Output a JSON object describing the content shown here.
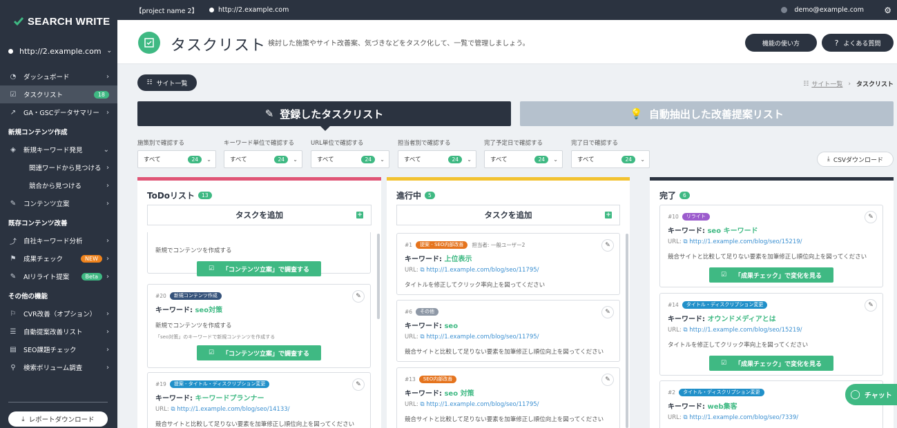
{
  "sidebar": {
    "logo": "SEARCH WRITE",
    "site": "http://2.example.com",
    "items": [
      {
        "icon": "speedometer-icon",
        "label": "ダッシュボード"
      },
      {
        "icon": "checklist-icon",
        "label": "タスクリスト",
        "badge": "18"
      },
      {
        "icon": "chart-icon",
        "label": "GA・GSCデータサマリー"
      }
    ],
    "section_new": "新規コンテンツ作成",
    "new_items": [
      {
        "icon": "layers-icon",
        "label": "新規キーワード発見"
      },
      {
        "label": "関連ワードから見つける"
      },
      {
        "label": "競合から見つける"
      },
      {
        "icon": "edit-icon",
        "label": "コンテンツ立案"
      }
    ],
    "section_existing": "既存コンテンツ改善",
    "existing_items": [
      {
        "icon": "trend-icon",
        "label": "自社キーワード分析"
      },
      {
        "icon": "flag-icon",
        "label": "成果チェック",
        "badge": "NEW"
      },
      {
        "icon": "ai-edit-icon",
        "label": "AIリライト提案",
        "badge": "Beta"
      }
    ],
    "section_other": "その他の機能",
    "other_items": [
      {
        "icon": "flag-outline-icon",
        "label": "CVR改善（オプション）"
      },
      {
        "icon": "list-icon",
        "label": "自動提案改善リスト"
      },
      {
        "icon": "seo-icon",
        "label": "SEO課題チェック"
      },
      {
        "icon": "search-icon",
        "label": "検索ボリューム調査"
      }
    ],
    "report_btn": "レポートダウンロード"
  },
  "topbar": {
    "project": "【project name 2】",
    "site": "http://2.example.com",
    "user": "demo@example.com"
  },
  "header": {
    "title": "タスクリスト",
    "desc": "検討した施策やサイト改善案、気づきなどをタスク化して、一覧で管理しましょう。",
    "btn_usage": "機能の使い方",
    "btn_faq": "よくある質問"
  },
  "site_list_btn": "サイト一覧",
  "breadcrumb": {
    "link": "サイト一覧",
    "current": "タスクリスト"
  },
  "tabs": {
    "registered": "登録したタスクリスト",
    "auto": "自動抽出した改善提案リスト"
  },
  "filters": [
    {
      "label": "施策別で確認する",
      "value": "すべて",
      "count": "24"
    },
    {
      "label": "キーワード単位で確認する",
      "value": "すべて",
      "count": "24"
    },
    {
      "label": "URL単位で確認する",
      "value": "すべて",
      "count": "24"
    },
    {
      "label": "担当者別で確認する",
      "value": "すべて",
      "count": "24"
    },
    {
      "label": "完了予定日で確認する",
      "value": "すべて",
      "count": "24"
    },
    {
      "label": "完了日で確認する",
      "value": "すべて",
      "count": "24"
    }
  ],
  "csv_btn": "CSVダウンロード",
  "add_task": "タスクを追加",
  "kw_label": "キーワード: ",
  "url_label": "URL: ",
  "columns": {
    "todo": {
      "title": "ToDoリスト",
      "count": "13",
      "color": "#e05576"
    },
    "doing": {
      "title": "進行中",
      "count": "5",
      "color": "#f2c230"
    },
    "done": {
      "title": "完了",
      "count": "6",
      "color": "#2b3340"
    }
  },
  "todo_cards": {
    "partial": {
      "desc": "新規でコンテンツを作成する",
      "btn": "「コンテンツ立案」で調査する"
    },
    "c20": {
      "id": "#20",
      "tag": "新規コンテンツ作成",
      "keyword": "seo対策",
      "desc": "新規でコンテンツを作成する",
      "note": "「seo対策」のキーワードで新規コンテンツを作成する",
      "btn": "「コンテンツ立案」で調査する"
    },
    "c19": {
      "id": "#19",
      "tag": "提案 - タイトル・ディスクリプション変更",
      "keyword": "キーワードプランナー",
      "url": "http://1.example.com/blog/seo/14133/",
      "desc": "競合サイトと比較して足りない要素を加筆修正し順位向上を図ってください"
    }
  },
  "doing_cards": {
    "c1": {
      "id": "#1",
      "tag": "提案 - SEO内部改善",
      "assignee": "担当者: 一般ユーザー2",
      "keyword": "上位表示",
      "url": "http://1.example.com/blog/seo/11795/",
      "desc": "タイトルを修正してクリック率向上を図ってください"
    },
    "c6": {
      "id": "#6",
      "tag": "その他",
      "keyword": "seo",
      "url": "http://1.example.com/blog/seo/11795/",
      "desc": "競合サイトと比較して足りない要素を加筆修正し順位向上を図ってください"
    },
    "c13": {
      "id": "#13",
      "tag": "SEO内部改善",
      "keyword": "seo 対策",
      "url": "http://1.example.com/blog/seo/11795/",
      "desc": "競合サイトと比較して足りない要素を加筆修正し順位向上を図ってください"
    }
  },
  "done_cards": {
    "c10": {
      "id": "#10",
      "tag": "リライト",
      "keyword": "seo キーワード",
      "url": "http://1.example.com/blog/seo/15219/",
      "desc": "競合サイトと比較して足りない要素を加筆修正し順位向上を図ってください",
      "btn": "「成果チェック」で変化を見る"
    },
    "c14": {
      "id": "#14",
      "tag": "タイトル・ディスクリプション変更",
      "keyword": "オウンドメディアとは",
      "url": "http://1.example.com/blog/seo/15219/",
      "desc": "タイトルを修正してクリック率向上を図ってください",
      "btn": "「成果チェック」で変化を見る"
    },
    "c2": {
      "id": "#2",
      "tag": "タイトル・ディスクリプション変更",
      "keyword": "web集客",
      "url": "http://1.example.com/blog/seo/7339/"
    }
  },
  "chat": "チャット"
}
